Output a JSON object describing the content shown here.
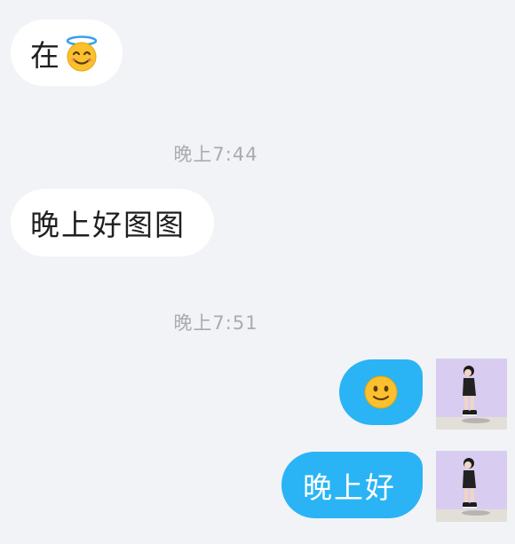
{
  "conversation": {
    "messages": [
      {
        "side": "incoming",
        "text": "在",
        "emoji": "smiling-face-with-halo-icon"
      },
      {
        "type": "timestamp",
        "text": "晚上7:44"
      },
      {
        "side": "incoming",
        "text": "晚上好图图"
      },
      {
        "type": "timestamp",
        "text": "晚上7:51"
      },
      {
        "side": "outgoing",
        "emoji": "slightly-smiling-face-icon"
      },
      {
        "side": "outgoing",
        "text": "晚上好"
      }
    ]
  },
  "colors": {
    "background": "#f2f3f6",
    "incoming_bubble": "#ffffff",
    "outgoing_bubble": "#2ab4f5",
    "timestamp_text": "#a9abb0",
    "avatar_background": "#d8cdf0"
  }
}
